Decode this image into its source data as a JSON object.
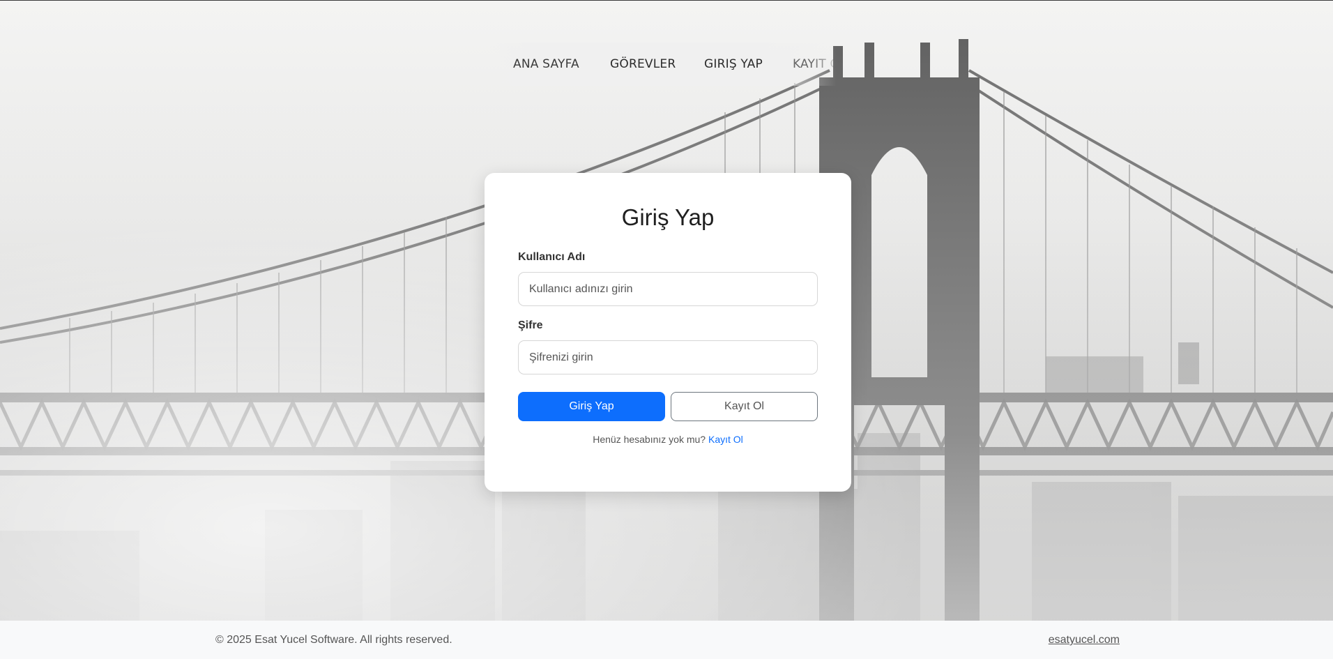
{
  "nav": {
    "items": [
      {
        "label": "ANA SAYFA"
      },
      {
        "label": "GÖREVLER"
      },
      {
        "label": "GIRIŞ YAP"
      },
      {
        "label": "KAYIT OL"
      }
    ]
  },
  "login": {
    "title": "Giriş Yap",
    "username_label": "Kullanıcı Adı",
    "username_placeholder": "Kullanıcı adınızı girin",
    "username_value": "",
    "password_label": "Şifre",
    "password_placeholder": "Şifrenizi girin",
    "password_value": "",
    "submit_label": "Giriş Yap",
    "register_button_label": "Kayıt Ol",
    "hint_text": "Henüz hesabınız yok mu?",
    "hint_link": "Kayıt Ol"
  },
  "footer": {
    "copyright": "© 2025 Esat Yucel Software. All rights reserved.",
    "site_link": "esatyucel.com"
  },
  "colors": {
    "primary": "#0d6efd",
    "card": "#ffffff",
    "footer_bg": "#f8f9fa"
  }
}
